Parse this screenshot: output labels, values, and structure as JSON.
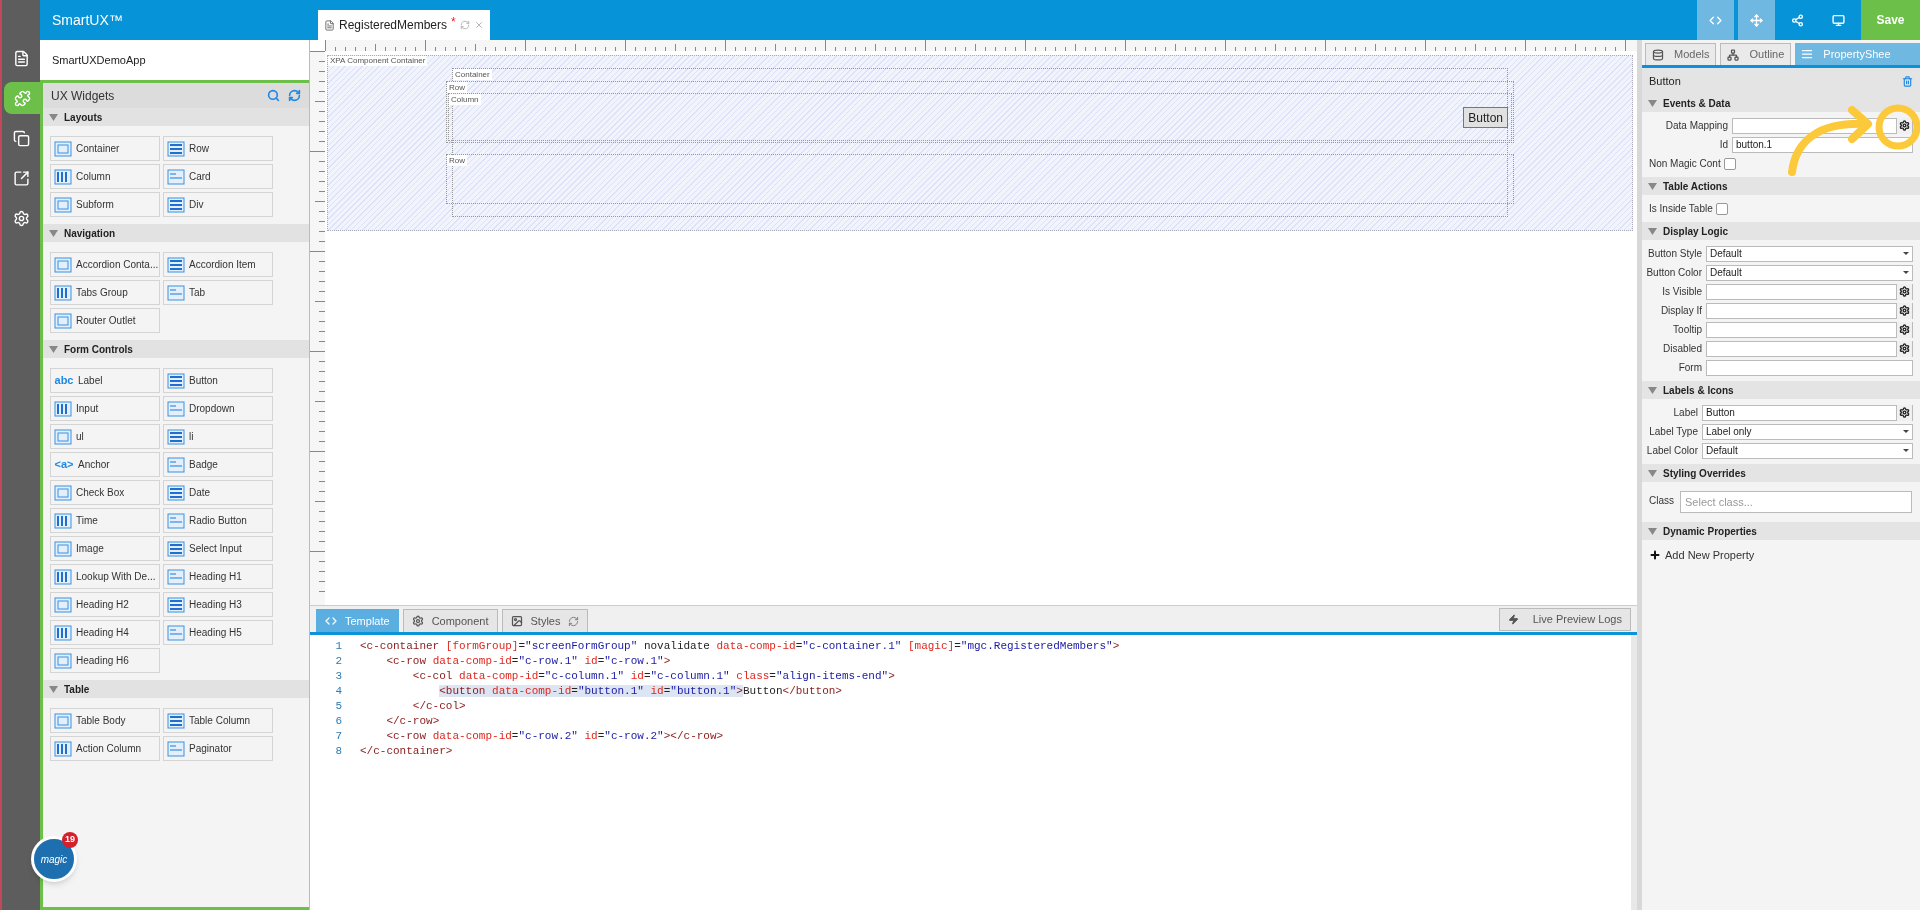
{
  "app": {
    "title": "SmartUX™",
    "save": "Save"
  },
  "rail": [
    {
      "selected": false
    },
    {
      "selected": true
    },
    {
      "selected": false
    },
    {
      "selected": false
    },
    {
      "selected": false
    }
  ],
  "editor_tabs": [
    {
      "label": "RegisteredMembers",
      "mark": "*",
      "selected": true
    }
  ],
  "toolbar": [
    {
      "selected": true
    },
    {
      "selected": true
    },
    {
      "selected": false
    },
    {
      "selected": false
    }
  ],
  "project": {
    "name": "SmartUXDemoApp"
  },
  "widgets": {
    "title": "UX Widgets",
    "groups": [
      {
        "title": "Layouts",
        "expanded": true,
        "items": [
          {
            "label": "Container"
          },
          {
            "label": "Row"
          },
          {
            "label": "Column"
          },
          {
            "label": "Card"
          },
          {
            "label": "Subform"
          },
          {
            "label": "Div"
          }
        ]
      },
      {
        "title": "Navigation",
        "expanded": true,
        "items": [
          {
            "label": "Accordion Conta..."
          },
          {
            "label": "Accordion Item"
          },
          {
            "label": "Tabs Group"
          },
          {
            "label": "Tab"
          },
          {
            "label": "Router Outlet"
          }
        ]
      },
      {
        "title": "Form Controls",
        "expanded": true,
        "items": [
          {
            "label": "Label",
            "badge": "abc"
          },
          {
            "label": "Button"
          },
          {
            "label": "Input"
          },
          {
            "label": "Dropdown"
          },
          {
            "label": "ul"
          },
          {
            "label": "li"
          },
          {
            "label": "Anchor",
            "badge": "<a>"
          },
          {
            "label": "Badge"
          },
          {
            "label": "Check Box"
          },
          {
            "label": "Date"
          },
          {
            "label": "Time"
          },
          {
            "label": "Radio Button"
          },
          {
            "label": "Image"
          },
          {
            "label": "Select Input"
          },
          {
            "label": "Lookup With De..."
          },
          {
            "label": "Heading H1"
          },
          {
            "label": "Heading H2"
          },
          {
            "label": "Heading H3"
          },
          {
            "label": "Heading H4"
          },
          {
            "label": "Heading H5"
          },
          {
            "label": "Heading H6"
          }
        ]
      },
      {
        "title": "Table",
        "expanded": true,
        "items": [
          {
            "label": "Table Body"
          },
          {
            "label": "Table Column"
          },
          {
            "label": "Action Column"
          },
          {
            "label": "Paginator"
          }
        ]
      }
    ]
  },
  "magic_badge": {
    "label": "magic",
    "count": "19"
  },
  "canvas": {
    "root_label": "XPA Component Container",
    "container_label": "Container",
    "rows": [
      {
        "label": "Row",
        "column_label": "Column",
        "button": "Button"
      },
      {
        "label": "Row"
      }
    ]
  },
  "bottom_tabs": [
    {
      "label": "Template",
      "selected": true
    },
    {
      "label": "Component",
      "selected": false
    },
    {
      "label": "Styles",
      "selected": false
    }
  ],
  "live_preview": "Live Preview Logs",
  "code": [
    {
      "number": "1",
      "segments": [
        {
          "text": "<c-container [formGroup]=\"screenFormGroup\" novalidate data-comp-id=\"c-container.1\" [magic]=\"mgc.RegisteredMembers\">",
          "selected": false
        }
      ]
    },
    {
      "number": "2",
      "segments": [
        {
          "text": "    <c-row data-comp-id=\"c-row.1\" id=\"c-row.1\">",
          "selected": false
        }
      ]
    },
    {
      "number": "3",
      "segments": [
        {
          "text": "        <c-col data-comp-id=\"c-column.1\" id=\"c-column.1\" class=\"align-items-end\">",
          "selected": false
        }
      ]
    },
    {
      "number": "4",
      "segments": [
        {
          "text": "            <button data-comp-id=\"button.1\" id=\"button.1\">",
          "selected": true
        },
        {
          "text": "Button</button>",
          "selected": false
        }
      ]
    },
    {
      "number": "5",
      "segments": [
        {
          "text": "        </c-col>",
          "selected": false
        }
      ]
    },
    {
      "number": "6",
      "segments": [
        {
          "text": "    </c-row>",
          "selected": false
        }
      ]
    },
    {
      "number": "7",
      "segments": [
        {
          "text": "    <c-row data-comp-id=\"c-row.2\" id=\"c-row.2\"></c-row>",
          "selected": false
        }
      ]
    },
    {
      "number": "8",
      "segments": [
        {
          "text": "</c-container>",
          "selected": false
        }
      ]
    }
  ],
  "properties": {
    "tabs": [
      {
        "label": "Models",
        "selected": false
      },
      {
        "label": "Outline",
        "selected": false
      },
      {
        "label": "PropertyShee",
        "selected": true
      }
    ],
    "title": "Button",
    "sections": [
      {
        "title": "Events & Data",
        "expanded": true,
        "rows": [
          {
            "kind": "gear",
            "label": "Data Mapping"
          },
          {
            "kind": "input",
            "label": "Id",
            "value": "button.1"
          },
          {
            "kind": "checkbox",
            "label": "Non Magic Cont",
            "checked": false
          }
        ]
      },
      {
        "title": "Table Actions",
        "expanded": true,
        "rows": [
          {
            "kind": "checkbox",
            "label": "Is Inside Table",
            "checked": false
          }
        ]
      },
      {
        "title": "Display Logic",
        "expanded": true,
        "rows": [
          {
            "kind": "select",
            "label": "Button Style",
            "value": "Default"
          },
          {
            "kind": "select",
            "label": "Button Color",
            "value": "Default"
          },
          {
            "kind": "gear",
            "label": "Is Visible"
          },
          {
            "kind": "gear",
            "label": "Display If"
          },
          {
            "kind": "gear",
            "label": "Tooltip"
          },
          {
            "kind": "gear",
            "label": "Disabled"
          },
          {
            "kind": "input",
            "label": "Form"
          }
        ]
      },
      {
        "title": "Labels & Icons",
        "expanded": true,
        "rows": [
          {
            "kind": "gear",
            "label": "Label",
            "value": "Button"
          },
          {
            "kind": "select",
            "label": "Label Type",
            "value": "Label only"
          },
          {
            "kind": "select",
            "label": "Label Color",
            "value": "Default"
          }
        ]
      },
      {
        "title": "Styling Overrides",
        "expanded": true,
        "rows": [
          {
            "kind": "class",
            "label": "Class",
            "placeholder": "Select class..."
          }
        ]
      },
      {
        "title": "Dynamic Properties",
        "expanded": true,
        "rows": [
          {
            "kind": "add",
            "label": "Add New Property"
          }
        ]
      }
    ]
  }
}
